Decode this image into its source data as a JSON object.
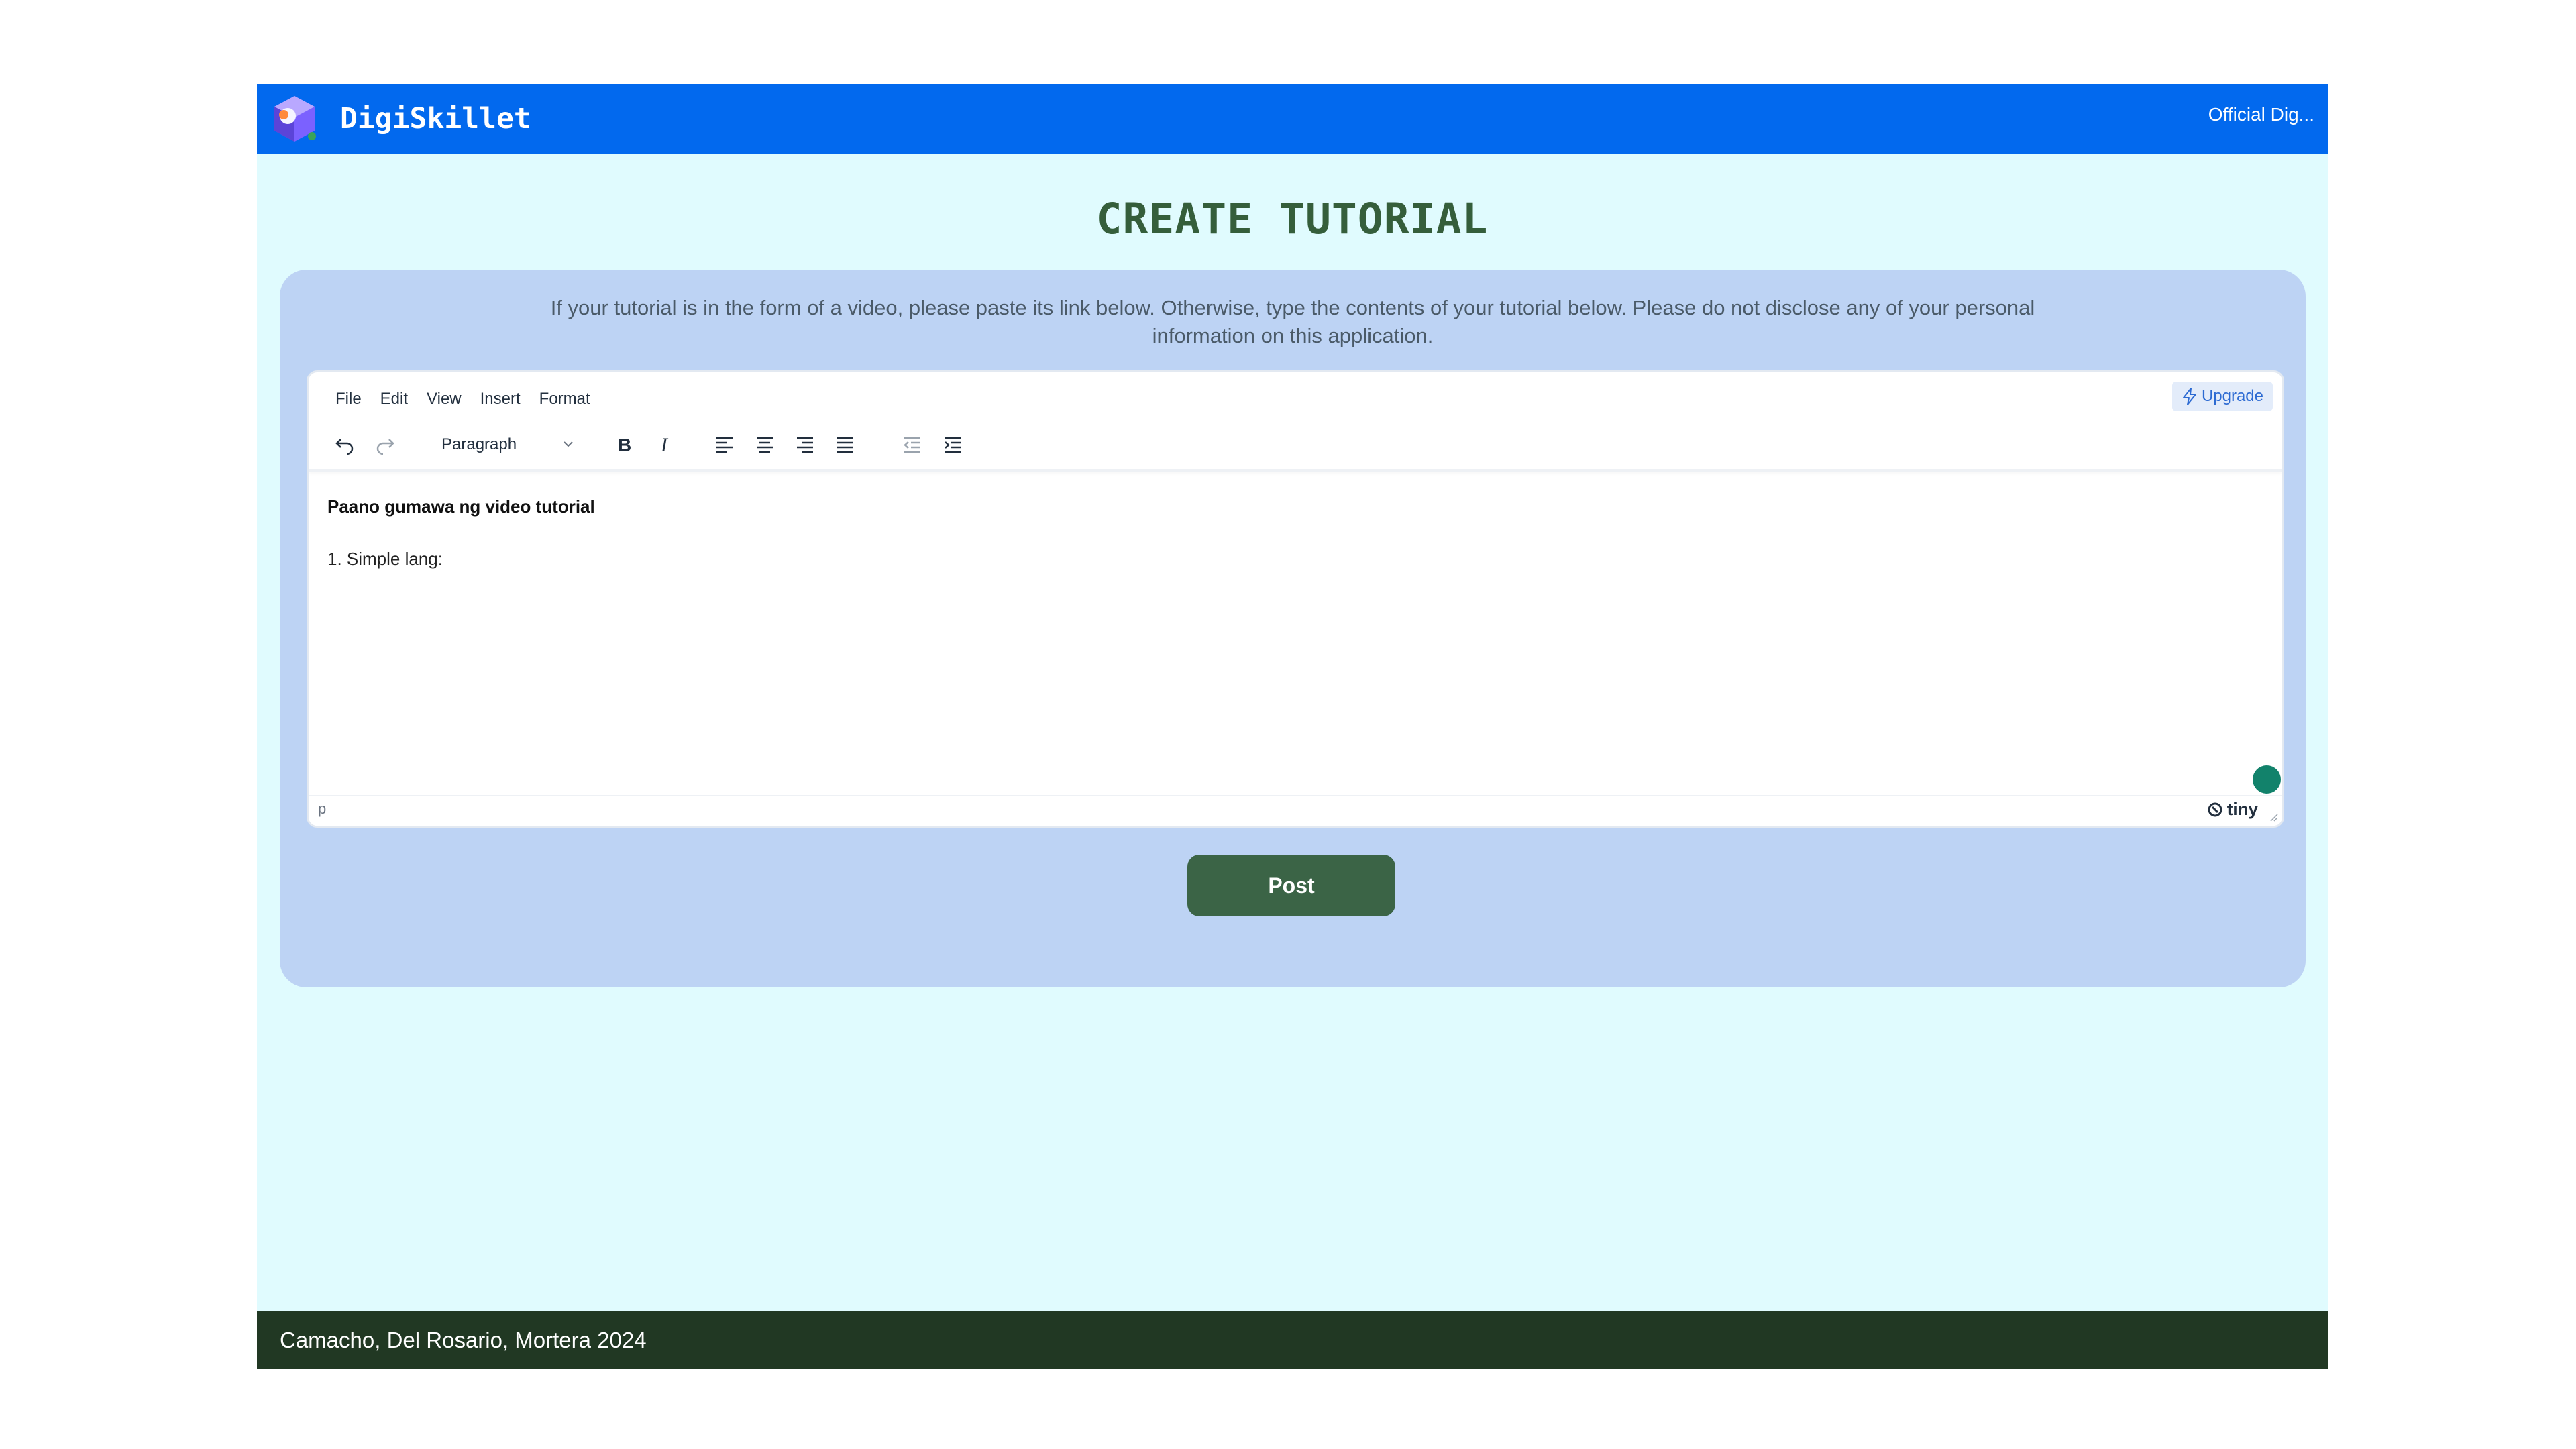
{
  "header": {
    "brand": "DigiSkillet",
    "account_label": "Official Dig..."
  },
  "page": {
    "title": "CREATE TUTORIAL",
    "instructions": "If your tutorial is in the form of a video, please paste its link below. Otherwise, type the contents of your tutorial below. Please do not disclose any of your personal information on this application."
  },
  "editor": {
    "menu": [
      "File",
      "Edit",
      "View",
      "Insert",
      "Format"
    ],
    "upgrade_label": "Upgrade",
    "block_format": "Paragraph",
    "toolbar_icons": [
      "undo-icon",
      "redo-icon",
      "bold-icon",
      "italic-icon",
      "align-left-icon",
      "align-center-icon",
      "align-right-icon",
      "align-justify-icon",
      "outdent-icon",
      "indent-icon"
    ],
    "content": {
      "heading": "Paano gumawa ng video tutorial",
      "line": "1. Simple lang:"
    },
    "status_path": "p",
    "brand": "tiny"
  },
  "actions": {
    "post_label": "Post"
  },
  "footer": {
    "text": "Camacho, Del Rosario, Mortera 2024"
  },
  "colors": {
    "header_bg": "#0269ee",
    "page_bg": "#e0fbfe",
    "card_bg": "#bdd3f4",
    "title": "#355e3b",
    "post_button": "#3b6446",
    "footer_bg": "#213823"
  }
}
